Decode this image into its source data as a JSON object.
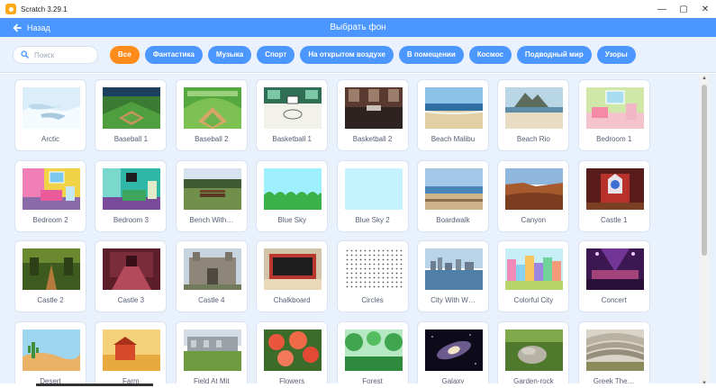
{
  "window": {
    "title": "Scratch 3.29.1",
    "minimize_glyph": "—",
    "maximize_glyph": "▢",
    "close_glyph": "✕"
  },
  "header": {
    "back_label": "Назад",
    "title": "Выбрать фон"
  },
  "search": {
    "placeholder": "Поиск"
  },
  "tags": [
    {
      "label": "Все",
      "active": true
    },
    {
      "label": "Фантастика"
    },
    {
      "label": "Музыка"
    },
    {
      "label": "Спорт"
    },
    {
      "label": "На открытом воздухе"
    },
    {
      "label": "В помещении"
    },
    {
      "label": "Космос"
    },
    {
      "label": "Подводный мир"
    },
    {
      "label": "Узоры"
    }
  ],
  "backdrops": [
    {
      "name": "Arctic",
      "icon": "arctic-thumbnail"
    },
    {
      "name": "Baseball 1",
      "icon": "baseball-field-thumbnail"
    },
    {
      "name": "Baseball 2",
      "icon": "baseball-diamond-thumbnail"
    },
    {
      "name": "Basketball 1",
      "icon": "basketball-court-thumbnail"
    },
    {
      "name": "Basketball 2",
      "icon": "basketball-arena-thumbnail"
    },
    {
      "name": "Beach Malibu",
      "icon": "beach-thumbnail"
    },
    {
      "name": "Beach Rio",
      "icon": "beach-rio-thumbnail"
    },
    {
      "name": "Bedroom 1",
      "icon": "bedroom-thumbnail"
    },
    {
      "name": "Bedroom 2",
      "icon": "bedroom-thumbnail"
    },
    {
      "name": "Bedroom 3",
      "icon": "bedroom-thumbnail"
    },
    {
      "name": "Bench With…",
      "icon": "park-bench-thumbnail"
    },
    {
      "name": "Blue Sky",
      "icon": "blue-sky-thumbnail"
    },
    {
      "name": "Blue Sky 2",
      "icon": "blue-sky-thumbnail"
    },
    {
      "name": "Boardwalk",
      "icon": "boardwalk-thumbnail"
    },
    {
      "name": "Canyon",
      "icon": "canyon-thumbnail"
    },
    {
      "name": "Castle 1",
      "icon": "castle-thumbnail"
    },
    {
      "name": "Castle 2",
      "icon": "castle-path-thumbnail"
    },
    {
      "name": "Castle 3",
      "icon": "castle-hall-thumbnail"
    },
    {
      "name": "Castle 4",
      "icon": "castle-stone-thumbnail"
    },
    {
      "name": "Chalkboard",
      "icon": "chalkboard-thumbnail"
    },
    {
      "name": "Circles",
      "icon": "circles-pattern-thumbnail"
    },
    {
      "name": "City With W…",
      "icon": "city-water-thumbnail"
    },
    {
      "name": "Colorful City",
      "icon": "colorful-city-thumbnail"
    },
    {
      "name": "Concert",
      "icon": "concert-stage-thumbnail"
    },
    {
      "name": "Desert",
      "icon": "desert-thumbnail"
    },
    {
      "name": "Farm",
      "icon": "farm-thumbnail"
    },
    {
      "name": "Field At Mit",
      "icon": "field-thumbnail"
    },
    {
      "name": "Flowers",
      "icon": "flowers-thumbnail"
    },
    {
      "name": "Forest",
      "icon": "forest-thumbnail"
    },
    {
      "name": "Galaxy",
      "icon": "galaxy-thumbnail"
    },
    {
      "name": "Garden-rock",
      "icon": "garden-rock-thumbnail"
    },
    {
      "name": "Greek The…",
      "icon": "greek-theater-thumbnail"
    }
  ]
}
